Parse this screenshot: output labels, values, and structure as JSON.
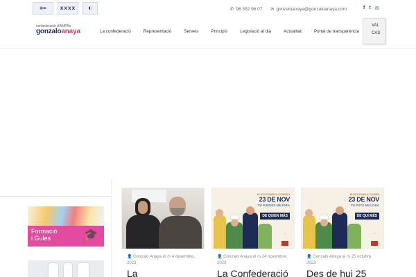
{
  "topbar": {
    "logos": [
      "Confederació logo",
      "Generalitat logo",
      "Council logo"
    ],
    "phone": "96 352 96 07",
    "email": "gonzaloanaya@gonzaloanaya.com",
    "social": [
      "f",
      "t",
      "✉"
    ]
  },
  "brand": {
    "small": "confederació",
    "ampa": "d'AMPAs",
    "name_a": "gonzalo",
    "name_b": "anaya"
  },
  "nav": {
    "items": [
      "La confederació",
      "Representació",
      "Serveis",
      "Principis",
      "Legislació al dia",
      "Actualitat",
      "Portal de transparència"
    ]
  },
  "lang": {
    "options": [
      "VAL",
      "CAS"
    ]
  },
  "sidebar": {
    "promo_line1": "Formació",
    "promo_line2": "i Gules"
  },
  "posts": [
    {
      "author": "Gonzalo Anaya el",
      "date_a": "4 desembre,",
      "date_b": "2023",
      "title": "La"
    },
    {
      "author": "Gonzalo Anaya el",
      "date_a": "24 novembre,",
      "date_b": "2023",
      "title": "La Confederació",
      "poster": {
        "l1": "ELECCIONES A CONSEJ",
        "l2": "23 DE NOV",
        "l3": "TÚ PUEDES MEJORA",
        "banner": "DE QUIEN MÁS"
      }
    },
    {
      "author": "Gonzalo Anaya el",
      "date_a": "25 octubre,",
      "date_b": "2023",
      "title": "Des de hui 25",
      "poster": {
        "l1": "ELECCIONS A CONSE",
        "l2": "23 DE NOV",
        "l3": "TU POTS MILLORA",
        "banner": "DE QUI MÉS"
      }
    }
  ],
  "colors": {
    "brand_navy": "#22335e",
    "brand_pink": "#d23a72",
    "promo_pink": "#e44ba0",
    "social_blue": "#1d4e89"
  }
}
